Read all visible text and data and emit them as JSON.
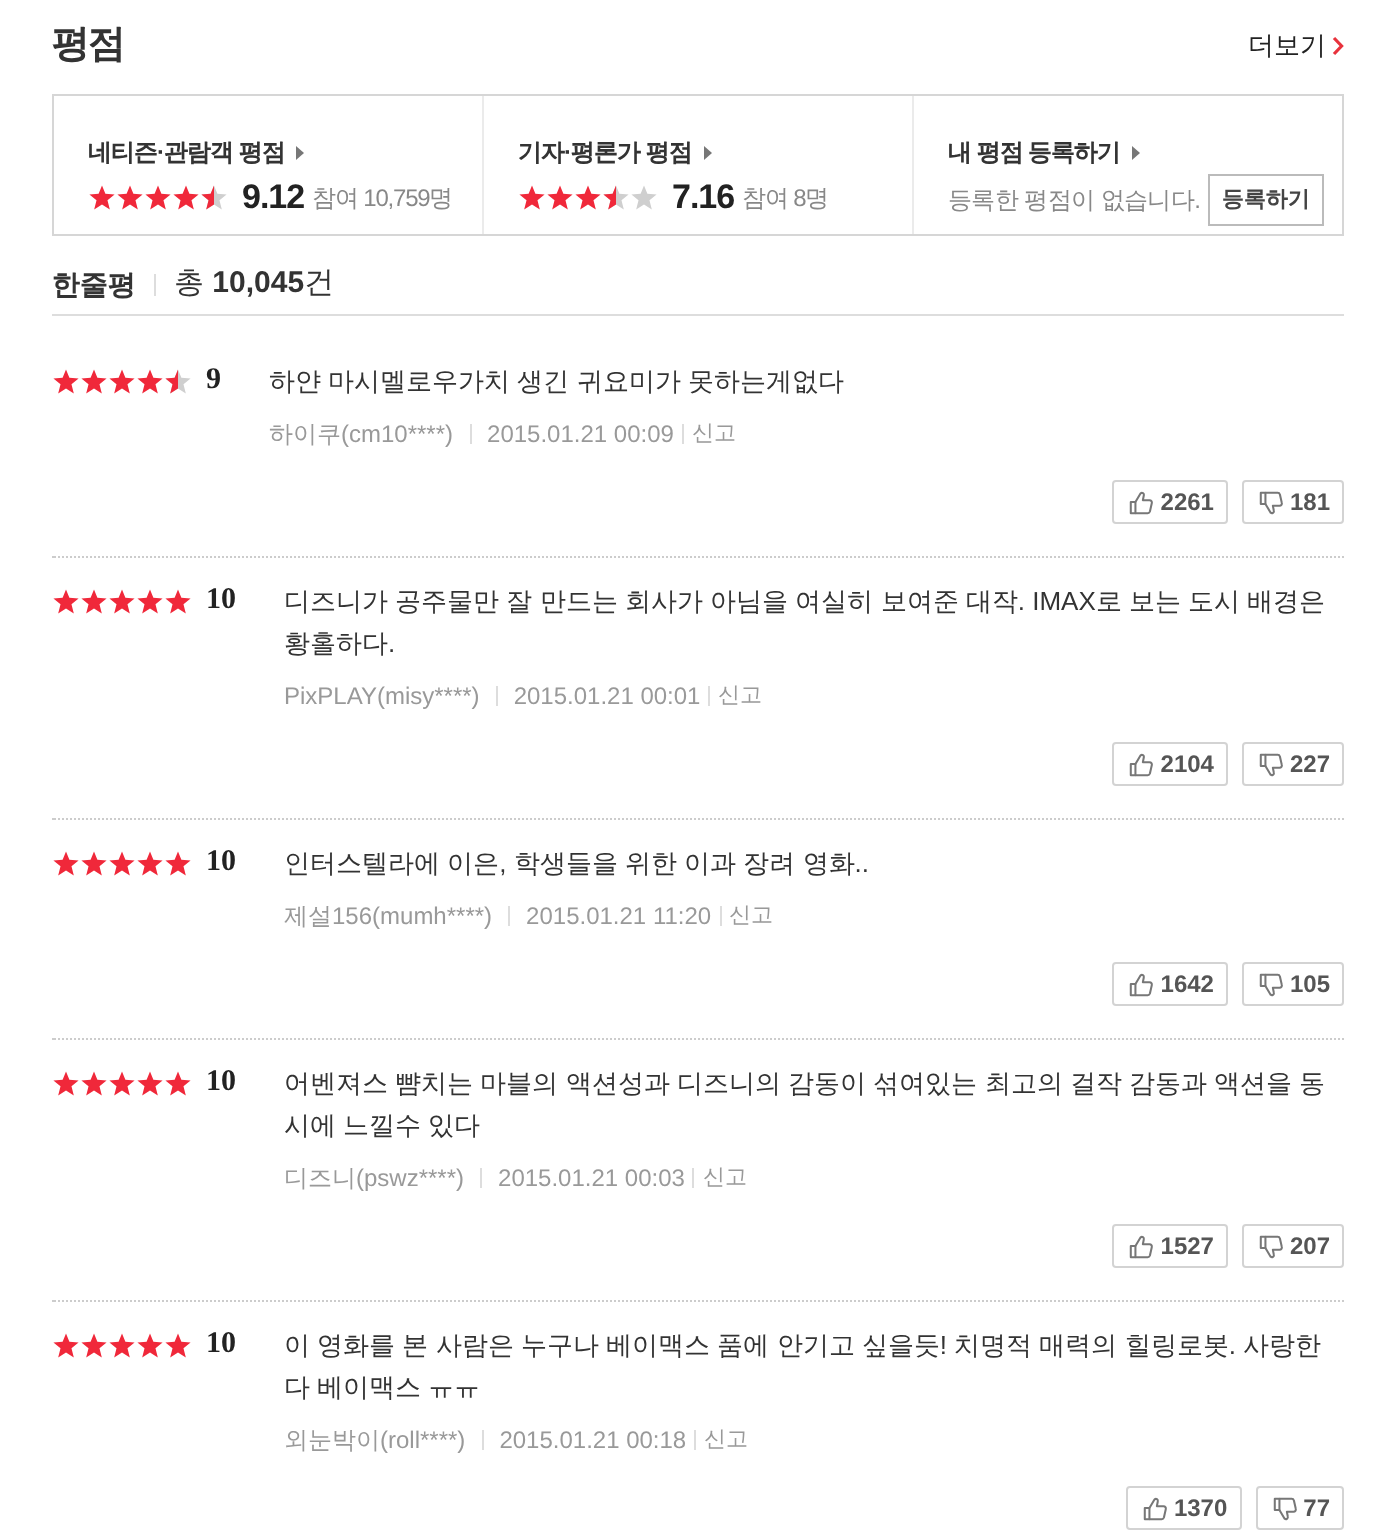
{
  "header": {
    "title": "평점",
    "more_link": "더보기"
  },
  "summary": [
    {
      "kind": "rating",
      "label": "네티즌·관람객 평점",
      "stars": 4.5,
      "score": "9.12",
      "participants": "참여 10,759명"
    },
    {
      "kind": "rating",
      "label": "기자·평론가 평점",
      "stars": 3.5,
      "score": "7.16",
      "participants": "참여 8명"
    },
    {
      "kind": "register",
      "label": "내 평점 등록하기",
      "message": "등록한 평점이 없습니다.",
      "button": "등록하기"
    }
  ],
  "comments_header": {
    "title": "한줄평",
    "total": "총 **10,045**건"
  },
  "reviews": [
    {
      "stars": 4.5,
      "score": "9",
      "text": "하얀 마시멜로우가치 생긴 귀요미가 못하는게없다",
      "author": "하이쿠(cm10****)",
      "date": "2015.01.21 00:09",
      "report": "신고",
      "likes": "2261",
      "dislikes": "181"
    },
    {
      "stars": 5,
      "score": "10",
      "text": "디즈니가 공주물만 잘 만드는 회사가 아님을 여실히 보여준 대작. IMAX로 보는 도시 배경은 황홀하다.",
      "author": "PixPLAY(misy****)",
      "date": "2015.01.21 00:01",
      "report": "신고",
      "likes": "2104",
      "dislikes": "227"
    },
    {
      "stars": 5,
      "score": "10",
      "text": "인터스텔라에 이은, 학생들을 위한 이과 장려 영화..",
      "author": "제설156(mumh****)",
      "date": "2015.01.21 11:20",
      "report": "신고",
      "likes": "1642",
      "dislikes": "105"
    },
    {
      "stars": 5,
      "score": "10",
      "text": "어벤져스 뺨치는 마블의 액션성과 디즈니의 감동이 섞여있는 최고의 걸작 감동과 액션을 동시에 느낄수 있다",
      "author": "디즈니(pswz****)",
      "date": "2015.01.21 00:03",
      "report": "신고",
      "likes": "1527",
      "dislikes": "207"
    },
    {
      "stars": 5,
      "score": "10",
      "text": "이 영화를 본 사람은 누구나 베이맥스 품에 안기고 싶을듯! 치명적 매력의 힐링로봇. 사랑한다 베이맥스 ㅠㅠ",
      "author": "외눈박이(roll****)",
      "date": "2015.01.21 00:18",
      "report": "신고",
      "likes": "1370",
      "dislikes": "77"
    }
  ]
}
